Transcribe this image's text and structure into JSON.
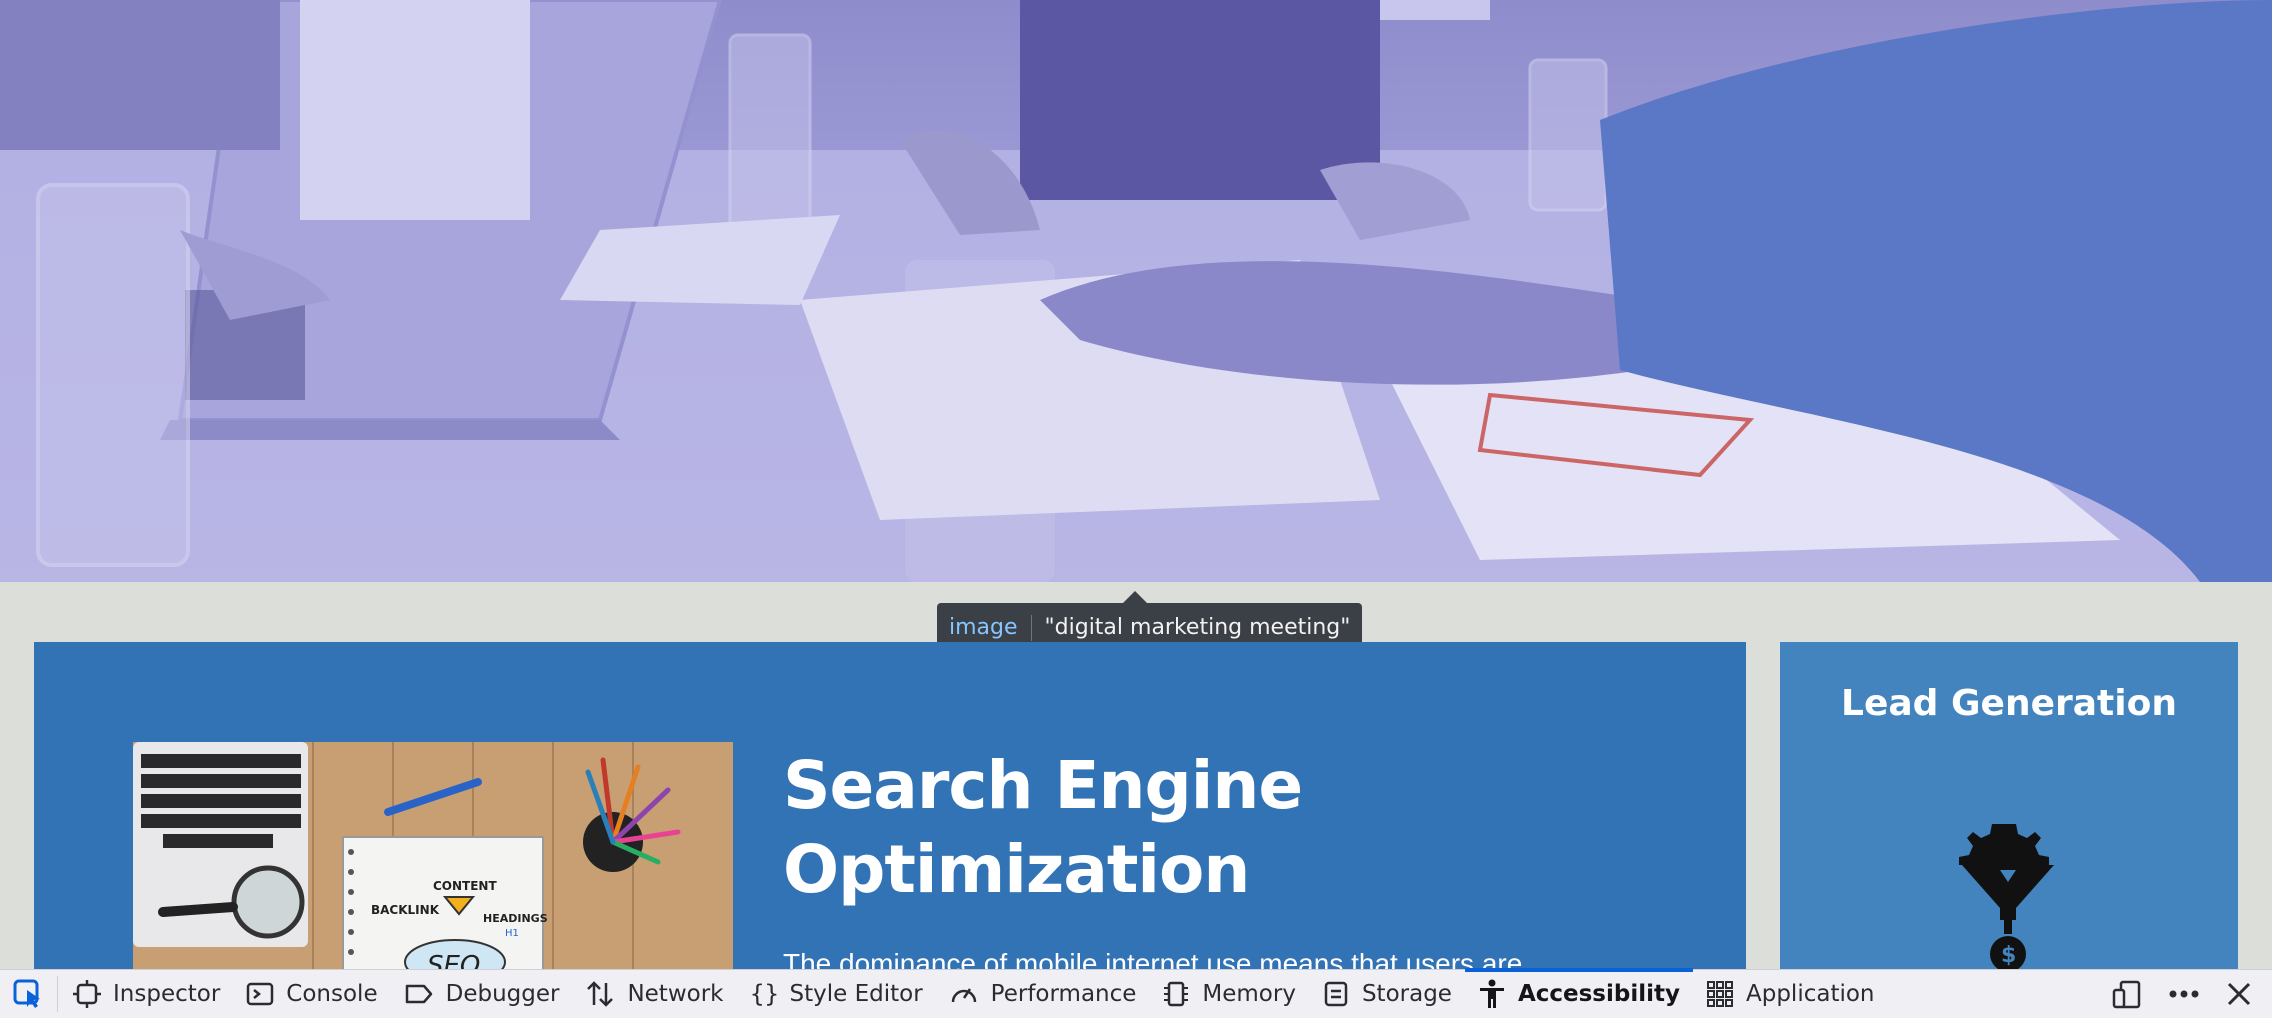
{
  "hero": {
    "alt": "digital marketing meeting"
  },
  "tooltip": {
    "role": "image",
    "name": "\"digital marketing meeting\""
  },
  "main": {
    "title_line1": "Search Engine",
    "title_line2": "Optimization",
    "body": "The dominance of mobile internet use means that users are",
    "image_words": {
      "content": "CONTENT",
      "backlink": "BACKLINK",
      "headings": "HEADINGS",
      "seo": "SEO",
      "h1": "H1"
    }
  },
  "side": {
    "title": "Lead Generation"
  },
  "devtools": {
    "tabs": [
      {
        "label": "Inspector",
        "icon": "inspector-icon"
      },
      {
        "label": "Console",
        "icon": "console-icon"
      },
      {
        "label": "Debugger",
        "icon": "debugger-icon"
      },
      {
        "label": "Network",
        "icon": "network-icon"
      },
      {
        "label": "Style Editor",
        "icon": "style-editor-icon"
      },
      {
        "label": "Performance",
        "icon": "performance-icon"
      },
      {
        "label": "Memory",
        "icon": "memory-icon"
      },
      {
        "label": "Storage",
        "icon": "storage-icon"
      },
      {
        "label": "Accessibility",
        "icon": "accessibility-icon",
        "active": true
      },
      {
        "label": "Application",
        "icon": "application-icon"
      }
    ]
  },
  "colors": {
    "panel": "#3273b5",
    "side": "#4384bf",
    "accent": "#0a62d8",
    "tooltip_role": "#86c5ff"
  }
}
